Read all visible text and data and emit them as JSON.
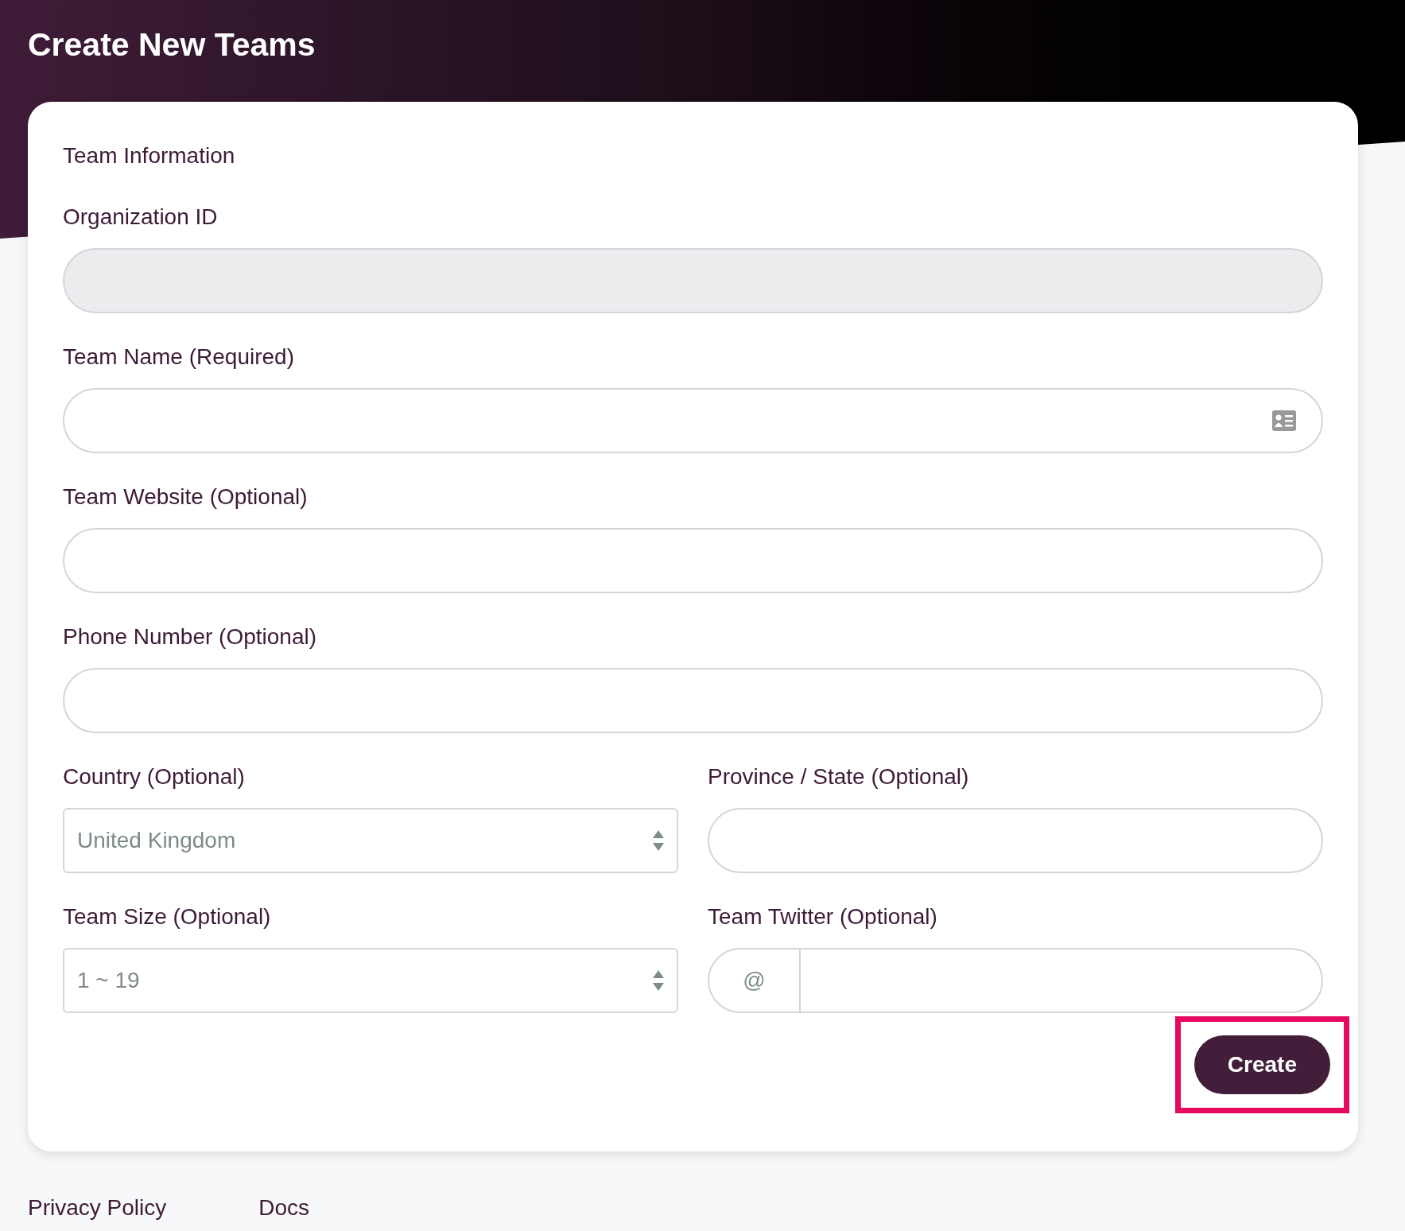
{
  "header": {
    "title": "Create New Teams"
  },
  "form": {
    "section_title": "Team Information",
    "rows": [
      [
        {
          "kind": "text",
          "label": "Organization ID",
          "disabled": true
        }
      ],
      [
        {
          "kind": "icon-text",
          "label": "Team Name (Required)",
          "disabled": false
        }
      ],
      [
        {
          "kind": "text",
          "label": "Team Website (Optional)",
          "disabled": false
        }
      ],
      [
        {
          "kind": "text",
          "label": "Phone Number (Optional)",
          "disabled": false
        }
      ],
      [
        {
          "kind": "select",
          "label": "Country (Optional)",
          "value": "United Kingdom",
          "disabled": false
        },
        {
          "kind": "text",
          "label": "Province / State (Optional)",
          "disabled": false
        }
      ],
      [
        {
          "kind": "select",
          "label": "Team Size (Optional)",
          "value": "1 ~ 19",
          "disabled": false
        },
        {
          "kind": "prefix",
          "label": "Team Twitter (Optional)",
          "prefix": "@",
          "disabled": false
        }
      ]
    ],
    "submit": {
      "label": "Create",
      "highlighted": true
    }
  },
  "footer": {
    "links": [
      "Privacy Policy",
      "Docs"
    ]
  }
}
